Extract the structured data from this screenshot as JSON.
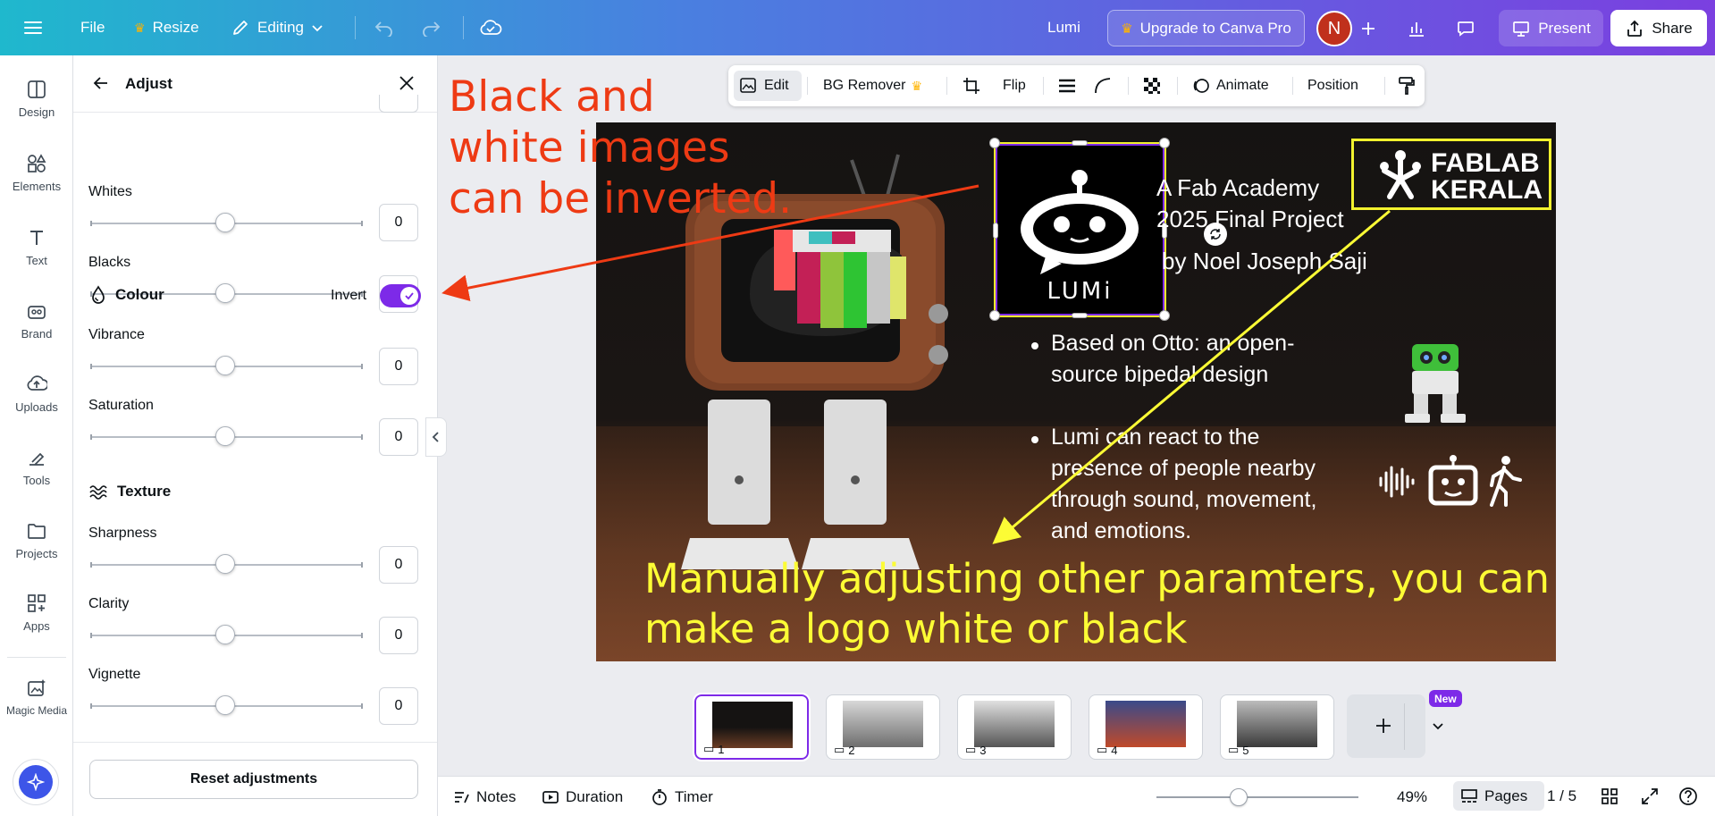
{
  "topbar": {
    "file": "File",
    "resize": "Resize",
    "editing": "Editing",
    "doc_name": "Lumi",
    "upgrade": "Upgrade to Canva Pro",
    "avatar_initial": "N",
    "present": "Present",
    "share": "Share"
  },
  "rail": {
    "items": [
      {
        "label": "Design",
        "icon": "design-icon"
      },
      {
        "label": "Elements",
        "icon": "elements-icon"
      },
      {
        "label": "Text",
        "icon": "text-icon"
      },
      {
        "label": "Brand",
        "icon": "brand-icon"
      },
      {
        "label": "Uploads",
        "icon": "uploads-icon"
      },
      {
        "label": "Tools",
        "icon": "tools-icon"
      },
      {
        "label": "Projects",
        "icon": "projects-icon"
      },
      {
        "label": "Apps",
        "icon": "apps-icon"
      },
      {
        "label": "Magic Media",
        "icon": "magic-media-icon"
      }
    ]
  },
  "panel": {
    "title": "Adjust",
    "sliders_light": [
      {
        "label": "Whites",
        "value": "0"
      },
      {
        "label": "Blacks",
        "value": "0"
      }
    ],
    "colour": {
      "heading": "Colour",
      "invert_label": "Invert",
      "invert_on": true,
      "sliders": [
        {
          "label": "Vibrance",
          "value": "0"
        },
        {
          "label": "Saturation",
          "value": "0"
        }
      ]
    },
    "texture": {
      "heading": "Texture",
      "sliders": [
        {
          "label": "Sharpness",
          "value": "0"
        },
        {
          "label": "Clarity",
          "value": "0"
        },
        {
          "label": "Vignette",
          "value": "0"
        }
      ]
    },
    "reset": "Reset adjustments"
  },
  "toolbar": {
    "edit": "Edit",
    "bg_remover": "BG Remover",
    "flip": "Flip",
    "animate": "Animate",
    "position": "Position"
  },
  "slide": {
    "logo_text": "LUMi",
    "fablab_line1": "FABLAB",
    "fablab_line2": "KERALA",
    "title_line1": "A Fab Academy",
    "title_line2": "2025 Final Project",
    "title_line3": "by Noel Joseph Saji",
    "bullet1_line1": "Based on Otto: an open-",
    "bullet1_line2": "source bipedal design",
    "bullet2_line1": "Lumi can react to the",
    "bullet2_line2": "presence of people nearby",
    "bullet2_line3": "through sound, movement,",
    "bullet2_line4": "and emotions."
  },
  "annotations": {
    "red_line1": "Black and",
    "red_line2": "white images",
    "red_line3": "can be inverted.",
    "yellow_line1": "Manually adjusting other paramters, you can",
    "yellow_line2": "make a logo white or black",
    "red_color": "#ee3a14",
    "yellow_color": "#fcfc35"
  },
  "pages": {
    "thumbs": [
      "1",
      "2",
      "3",
      "4",
      "5"
    ],
    "new_badge": "New"
  },
  "bottombar": {
    "notes": "Notes",
    "duration": "Duration",
    "timer": "Timer",
    "zoom": "49%",
    "pages": "Pages",
    "page_count": "1 / 5"
  },
  "colors": {
    "accent": "#7d2ae8",
    "upgrade_crown": "#ffb400"
  }
}
